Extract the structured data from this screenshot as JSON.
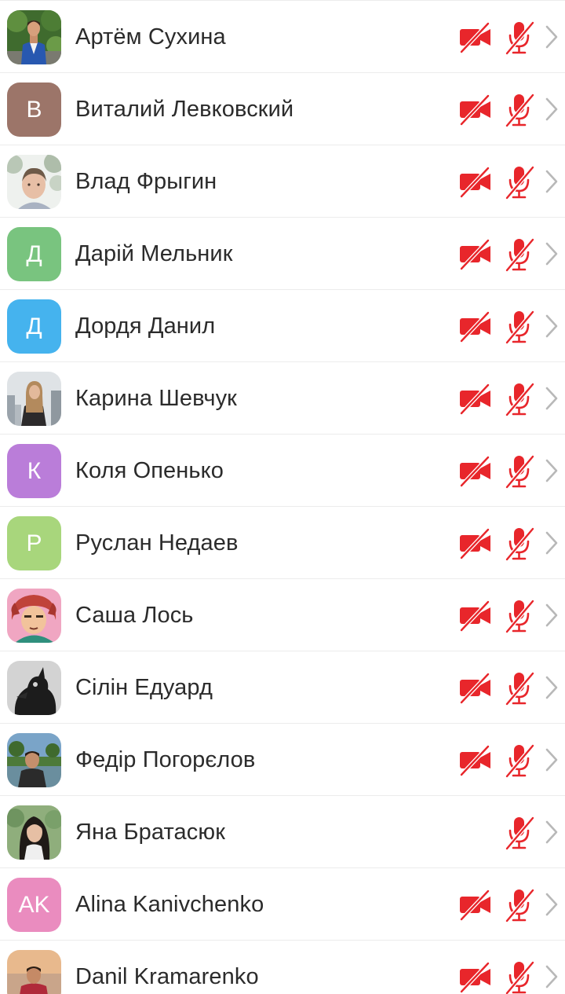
{
  "colors": {
    "mute_icon": "#e8262b",
    "chevron": "#b8b8b8",
    "name_text": "#2b2b2b",
    "divider": "#ececec"
  },
  "icons": {
    "camera": "video-camera-off-icon",
    "mic": "microphone-off-icon",
    "chevron": "chevron-right-icon"
  },
  "participants": [
    {
      "name": "Артём Сухина",
      "avatar_type": "photo",
      "avatar_photo": "man-blue-suit-outdoors",
      "camera_off": true
    },
    {
      "name": "Виталий Левковский",
      "avatar_type": "initials",
      "initials": "В",
      "avatar_color": "#9c7569",
      "camera_off": true
    },
    {
      "name": "Влад Фрыгин",
      "avatar_type": "photo",
      "avatar_photo": "selfie-under-trees",
      "camera_off": true
    },
    {
      "name": "Дарій Мельник",
      "avatar_type": "initials",
      "initials": "Д",
      "avatar_color": "#79c47f",
      "camera_off": true
    },
    {
      "name": "Дордя Данил",
      "avatar_type": "initials",
      "initials": "Д",
      "avatar_color": "#45b3ee",
      "camera_off": true
    },
    {
      "name": "Карина Шевчук",
      "avatar_type": "photo",
      "avatar_photo": "woman-city-background",
      "camera_off": true
    },
    {
      "name": "Коля Опенько",
      "avatar_type": "initials",
      "initials": "К",
      "avatar_color": "#ba7dd9",
      "camera_off": true
    },
    {
      "name": "Руслан Недаев",
      "avatar_type": "initials",
      "initials": "Р",
      "avatar_color": "#a8d67c",
      "camera_off": true
    },
    {
      "name": "Саша Лось",
      "avatar_type": "photo",
      "avatar_photo": "anime-character",
      "camera_off": true
    },
    {
      "name": "Сілін Едуард",
      "avatar_type": "photo",
      "avatar_photo": "bird-silhouette",
      "camera_off": true
    },
    {
      "name": "Федір Погорєлов",
      "avatar_type": "photo",
      "avatar_photo": "man-by-lake-sunset",
      "camera_off": true
    },
    {
      "name": "Яна Братасюк",
      "avatar_type": "photo",
      "avatar_photo": "woman-long-hair",
      "camera_off": false
    },
    {
      "name": "Alina Kanivchenko",
      "avatar_type": "initials",
      "initials": "AK",
      "avatar_color": "#ea8cbf",
      "camera_off": true
    },
    {
      "name": "Danil Kramarenko",
      "avatar_type": "photo",
      "avatar_photo": "man-by-sea",
      "camera_off": true
    }
  ]
}
